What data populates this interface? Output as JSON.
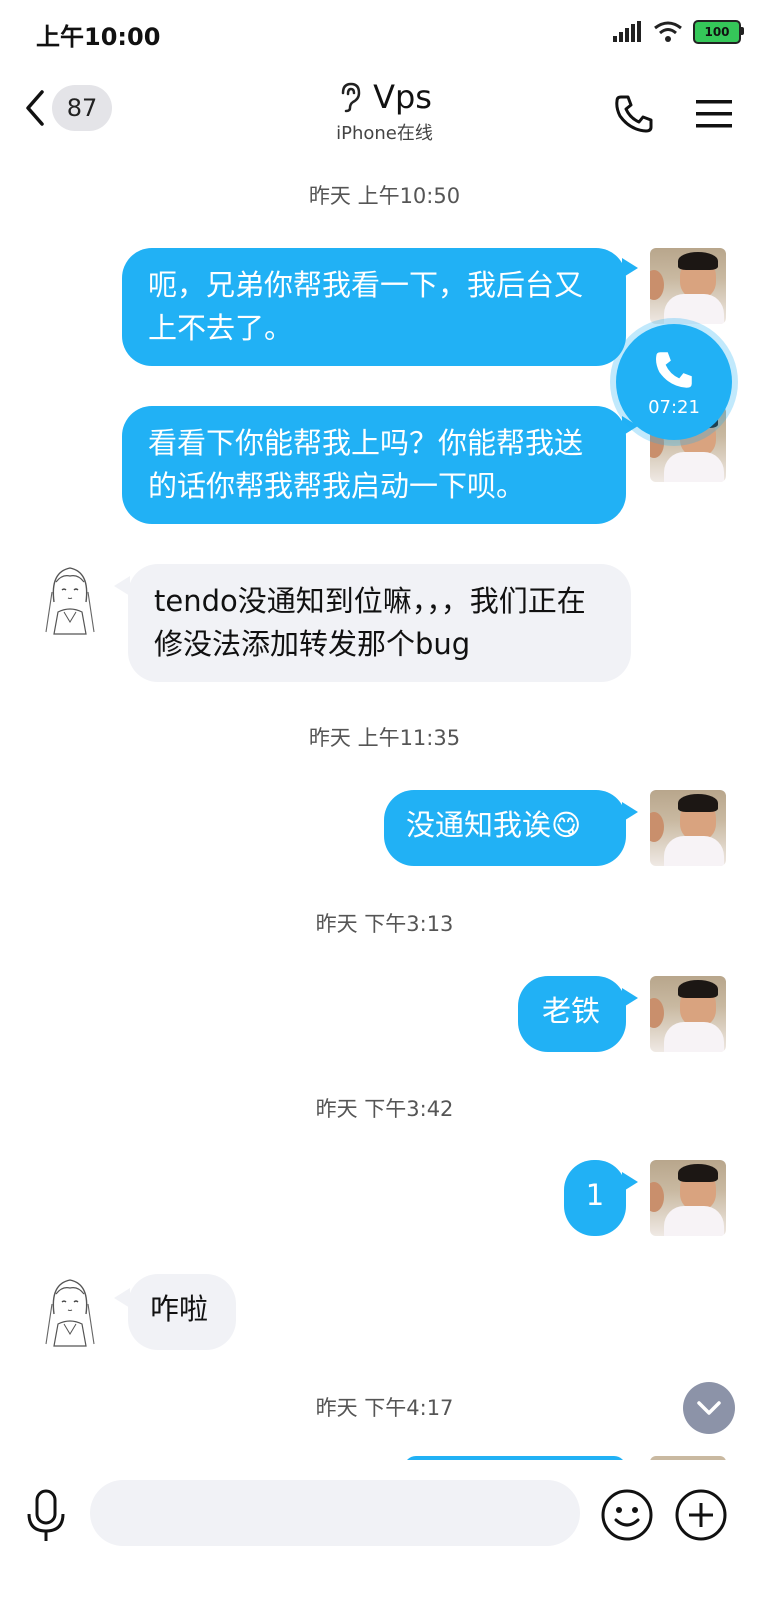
{
  "status_bar": {
    "time": "上午10:00",
    "battery": "100"
  },
  "header": {
    "back_count": "87",
    "title": "Vps",
    "subtitle": "iPhone在线"
  },
  "messages": [
    {
      "kind": "timestamp",
      "text": "昨天 上午10:50"
    },
    {
      "kind": "out",
      "text": "呃，兄弟你帮我看一下，我后台又上不去了。"
    },
    {
      "kind": "out",
      "text": "看看下你能帮我上吗？你能帮我送的话你帮我帮我启动一下呗。"
    },
    {
      "kind": "in",
      "text": "tendo没通知到位嘛，，，我们正在修没法添加转发那个bug"
    },
    {
      "kind": "timestamp",
      "text": "昨天 上午11:35"
    },
    {
      "kind": "out",
      "text": "没通知我诶😋"
    },
    {
      "kind": "timestamp",
      "text": "昨天 下午3:13"
    },
    {
      "kind": "out",
      "text": "老铁"
    },
    {
      "kind": "timestamp",
      "text": "昨天 下午3:42"
    },
    {
      "kind": "out",
      "text": "1"
    },
    {
      "kind": "in",
      "text": "咋啦"
    },
    {
      "kind": "timestamp",
      "text": "昨天 下午4:17"
    }
  ],
  "floating_call": {
    "duration": "07:21"
  },
  "input": {
    "placeholder": "",
    "value": ""
  },
  "colors": {
    "accent": "#21b1f5",
    "incoming_bubble": "#f1f2f6",
    "battery_fill": "#35c759"
  },
  "icons": {
    "back": "chevron-left-icon",
    "ear": "ear-icon",
    "call": "phone-icon",
    "menu": "hamburger-icon",
    "mic": "mic-icon",
    "emoji": "smile-icon",
    "plus": "plus-circle-icon",
    "scroll": "chevron-down-icon"
  }
}
